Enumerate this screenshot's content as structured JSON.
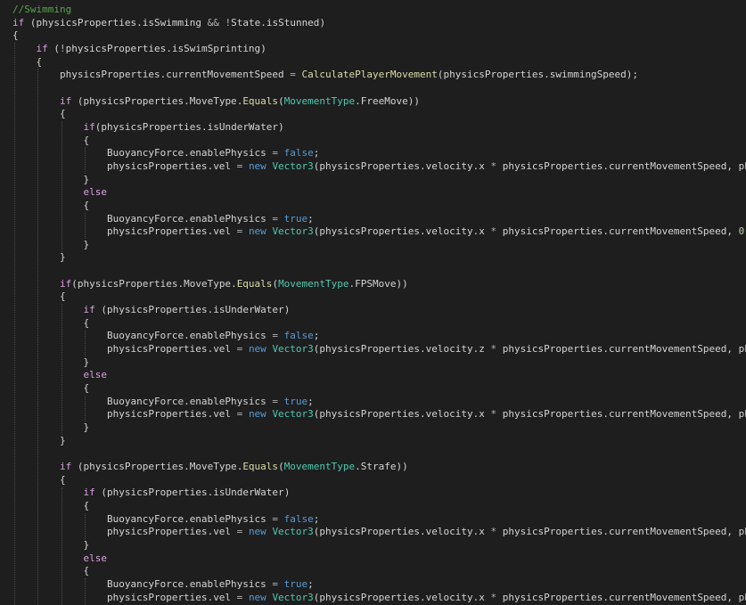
{
  "editor": {
    "language": "csharp",
    "colors": {
      "background": "#1e1e1e",
      "comment": "#57a64a",
      "keyword": "#569cd6",
      "control": "#d8a0df",
      "type": "#4ec9b0",
      "function": "#dcdcaa",
      "identifier": "#d4d4d4",
      "operator": "#b4b4b4",
      "number": "#b5cea8"
    },
    "lines": [
      [
        [
          "cm",
          "//Swimming"
        ]
      ],
      [
        [
          "ct",
          "if"
        ],
        [
          "pn",
          " ("
        ],
        [
          "id",
          "physicsProperties"
        ],
        [
          "pn",
          "."
        ],
        [
          "id",
          "isSwimming"
        ],
        [
          "op",
          " && "
        ],
        [
          "op",
          "!"
        ],
        [
          "id",
          "State"
        ],
        [
          "pn",
          "."
        ],
        [
          "id",
          "isStunned"
        ],
        [
          "pn",
          ")"
        ]
      ],
      [
        [
          "pn",
          "{"
        ]
      ],
      [
        [
          "pn",
          "    "
        ],
        [
          "ct",
          "if"
        ],
        [
          "pn",
          " ("
        ],
        [
          "op",
          "!"
        ],
        [
          "id",
          "physicsProperties"
        ],
        [
          "pn",
          "."
        ],
        [
          "id",
          "isSwimSprinting"
        ],
        [
          "pn",
          ")"
        ]
      ],
      [
        [
          "pn",
          "    {"
        ]
      ],
      [
        [
          "pn",
          "        "
        ],
        [
          "id",
          "physicsProperties"
        ],
        [
          "pn",
          "."
        ],
        [
          "id",
          "currentMovementSpeed"
        ],
        [
          "op",
          " = "
        ],
        [
          "fn",
          "CalculatePlayerMovement"
        ],
        [
          "pn",
          "("
        ],
        [
          "id",
          "physicsProperties"
        ],
        [
          "pn",
          "."
        ],
        [
          "id",
          "swimmingSpeed"
        ],
        [
          "pn",
          ");"
        ]
      ],
      [
        [
          "pn",
          ""
        ]
      ],
      [
        [
          "pn",
          "        "
        ],
        [
          "ct",
          "if"
        ],
        [
          "pn",
          " ("
        ],
        [
          "id",
          "physicsProperties"
        ],
        [
          "pn",
          "."
        ],
        [
          "id",
          "MoveType"
        ],
        [
          "pn",
          "."
        ],
        [
          "fn",
          "Equals"
        ],
        [
          "pn",
          "("
        ],
        [
          "ty",
          "MovementType"
        ],
        [
          "pn",
          "."
        ],
        [
          "id",
          "FreeMove"
        ],
        [
          "pn",
          "))"
        ]
      ],
      [
        [
          "pn",
          "        {"
        ]
      ],
      [
        [
          "pn",
          "            "
        ],
        [
          "ct",
          "if"
        ],
        [
          "pn",
          "("
        ],
        [
          "id",
          "physicsProperties"
        ],
        [
          "pn",
          "."
        ],
        [
          "id",
          "isUnderWater"
        ],
        [
          "pn",
          ")"
        ]
      ],
      [
        [
          "pn",
          "            {"
        ]
      ],
      [
        [
          "pn",
          "                "
        ],
        [
          "id",
          "BuoyancyForce"
        ],
        [
          "pn",
          "."
        ],
        [
          "id",
          "enablePhysics"
        ],
        [
          "op",
          " = "
        ],
        [
          "kw",
          "false"
        ],
        [
          "pn",
          ";"
        ]
      ],
      [
        [
          "pn",
          "                "
        ],
        [
          "id",
          "physicsProperties"
        ],
        [
          "pn",
          "."
        ],
        [
          "id",
          "vel"
        ],
        [
          "op",
          " = "
        ],
        [
          "kw",
          "new"
        ],
        [
          "pn",
          " "
        ],
        [
          "ty",
          "Vector3"
        ],
        [
          "pn",
          "("
        ],
        [
          "id",
          "physicsProperties"
        ],
        [
          "pn",
          "."
        ],
        [
          "id",
          "velocity"
        ],
        [
          "pn",
          "."
        ],
        [
          "id",
          "x"
        ],
        [
          "op",
          " * "
        ],
        [
          "id",
          "physicsProperties"
        ],
        [
          "pn",
          "."
        ],
        [
          "id",
          "currentMovementSpeed"
        ],
        [
          "pn",
          ", "
        ],
        [
          "id",
          "ph"
        ]
      ],
      [
        [
          "pn",
          "            }"
        ]
      ],
      [
        [
          "pn",
          "            "
        ],
        [
          "ct",
          "else"
        ]
      ],
      [
        [
          "pn",
          "            {"
        ]
      ],
      [
        [
          "pn",
          "                "
        ],
        [
          "id",
          "BuoyancyForce"
        ],
        [
          "pn",
          "."
        ],
        [
          "id",
          "enablePhysics"
        ],
        [
          "op",
          " = "
        ],
        [
          "kw",
          "true"
        ],
        [
          "pn",
          ";"
        ]
      ],
      [
        [
          "pn",
          "                "
        ],
        [
          "id",
          "physicsProperties"
        ],
        [
          "pn",
          "."
        ],
        [
          "id",
          "vel"
        ],
        [
          "op",
          " = "
        ],
        [
          "kw",
          "new"
        ],
        [
          "pn",
          " "
        ],
        [
          "ty",
          "Vector3"
        ],
        [
          "pn",
          "("
        ],
        [
          "id",
          "physicsProperties"
        ],
        [
          "pn",
          "."
        ],
        [
          "id",
          "velocity"
        ],
        [
          "pn",
          "."
        ],
        [
          "id",
          "x"
        ],
        [
          "op",
          " * "
        ],
        [
          "id",
          "physicsProperties"
        ],
        [
          "pn",
          "."
        ],
        [
          "id",
          "currentMovementSpeed"
        ],
        [
          "pn",
          ", "
        ],
        [
          "nm",
          "0"
        ]
      ],
      [
        [
          "pn",
          "            }"
        ]
      ],
      [
        [
          "pn",
          "        }"
        ]
      ],
      [
        [
          "pn",
          ""
        ]
      ],
      [
        [
          "pn",
          "        "
        ],
        [
          "ct",
          "if"
        ],
        [
          "pn",
          "("
        ],
        [
          "id",
          "physicsProperties"
        ],
        [
          "pn",
          "."
        ],
        [
          "id",
          "MoveType"
        ],
        [
          "pn",
          "."
        ],
        [
          "fn",
          "Equals"
        ],
        [
          "pn",
          "("
        ],
        [
          "ty",
          "MovementType"
        ],
        [
          "pn",
          "."
        ],
        [
          "id",
          "FPSMove"
        ],
        [
          "pn",
          "))"
        ]
      ],
      [
        [
          "pn",
          "        {"
        ]
      ],
      [
        [
          "pn",
          "            "
        ],
        [
          "ct",
          "if"
        ],
        [
          "pn",
          " ("
        ],
        [
          "id",
          "physicsProperties"
        ],
        [
          "pn",
          "."
        ],
        [
          "id",
          "isUnderWater"
        ],
        [
          "pn",
          ")"
        ]
      ],
      [
        [
          "pn",
          "            {"
        ]
      ],
      [
        [
          "pn",
          "                "
        ],
        [
          "id",
          "BuoyancyForce"
        ],
        [
          "pn",
          "."
        ],
        [
          "id",
          "enablePhysics"
        ],
        [
          "op",
          " = "
        ],
        [
          "kw",
          "false"
        ],
        [
          "pn",
          ";"
        ]
      ],
      [
        [
          "pn",
          "                "
        ],
        [
          "id",
          "physicsProperties"
        ],
        [
          "pn",
          "."
        ],
        [
          "id",
          "vel"
        ],
        [
          "op",
          " = "
        ],
        [
          "kw",
          "new"
        ],
        [
          "pn",
          " "
        ],
        [
          "ty",
          "Vector3"
        ],
        [
          "pn",
          "("
        ],
        [
          "id",
          "physicsProperties"
        ],
        [
          "pn",
          "."
        ],
        [
          "id",
          "velocity"
        ],
        [
          "pn",
          "."
        ],
        [
          "id",
          "z"
        ],
        [
          "op",
          " * "
        ],
        [
          "id",
          "physicsProperties"
        ],
        [
          "pn",
          "."
        ],
        [
          "id",
          "currentMovementSpeed"
        ],
        [
          "pn",
          ", "
        ],
        [
          "id",
          "ph"
        ]
      ],
      [
        [
          "pn",
          "            }"
        ]
      ],
      [
        [
          "pn",
          "            "
        ],
        [
          "ct",
          "else"
        ]
      ],
      [
        [
          "pn",
          "            {"
        ]
      ],
      [
        [
          "pn",
          "                "
        ],
        [
          "id",
          "BuoyancyForce"
        ],
        [
          "pn",
          "."
        ],
        [
          "id",
          "enablePhysics"
        ],
        [
          "op",
          " = "
        ],
        [
          "kw",
          "true"
        ],
        [
          "pn",
          ";"
        ]
      ],
      [
        [
          "pn",
          "                "
        ],
        [
          "id",
          "physicsProperties"
        ],
        [
          "pn",
          "."
        ],
        [
          "id",
          "vel"
        ],
        [
          "op",
          " = "
        ],
        [
          "kw",
          "new"
        ],
        [
          "pn",
          " "
        ],
        [
          "ty",
          "Vector3"
        ],
        [
          "pn",
          "("
        ],
        [
          "id",
          "physicsProperties"
        ],
        [
          "pn",
          "."
        ],
        [
          "id",
          "velocity"
        ],
        [
          "pn",
          "."
        ],
        [
          "id",
          "x"
        ],
        [
          "op",
          " * "
        ],
        [
          "id",
          "physicsProperties"
        ],
        [
          "pn",
          "."
        ],
        [
          "id",
          "currentMovementSpeed"
        ],
        [
          "pn",
          ", "
        ],
        [
          "id",
          "ph"
        ]
      ],
      [
        [
          "pn",
          "            }"
        ]
      ],
      [
        [
          "pn",
          "        }"
        ]
      ],
      [
        [
          "pn",
          ""
        ]
      ],
      [
        [
          "pn",
          "        "
        ],
        [
          "ct",
          "if"
        ],
        [
          "pn",
          " ("
        ],
        [
          "id",
          "physicsProperties"
        ],
        [
          "pn",
          "."
        ],
        [
          "id",
          "MoveType"
        ],
        [
          "pn",
          "."
        ],
        [
          "fn",
          "Equals"
        ],
        [
          "pn",
          "("
        ],
        [
          "ty",
          "MovementType"
        ],
        [
          "pn",
          "."
        ],
        [
          "id",
          "Strafe"
        ],
        [
          "pn",
          "))"
        ]
      ],
      [
        [
          "pn",
          "        {"
        ]
      ],
      [
        [
          "pn",
          "            "
        ],
        [
          "ct",
          "if"
        ],
        [
          "pn",
          " ("
        ],
        [
          "id",
          "physicsProperties"
        ],
        [
          "pn",
          "."
        ],
        [
          "id",
          "isUnderWater"
        ],
        [
          "pn",
          ")"
        ]
      ],
      [
        [
          "pn",
          "            {"
        ]
      ],
      [
        [
          "pn",
          "                "
        ],
        [
          "id",
          "BuoyancyForce"
        ],
        [
          "pn",
          "."
        ],
        [
          "id",
          "enablePhysics"
        ],
        [
          "op",
          " = "
        ],
        [
          "kw",
          "false"
        ],
        [
          "pn",
          ";"
        ]
      ],
      [
        [
          "pn",
          "                "
        ],
        [
          "id",
          "physicsProperties"
        ],
        [
          "pn",
          "."
        ],
        [
          "id",
          "vel"
        ],
        [
          "op",
          " = "
        ],
        [
          "kw",
          "new"
        ],
        [
          "pn",
          " "
        ],
        [
          "ty",
          "Vector3"
        ],
        [
          "pn",
          "("
        ],
        [
          "id",
          "physicsProperties"
        ],
        [
          "pn",
          "."
        ],
        [
          "id",
          "velocity"
        ],
        [
          "pn",
          "."
        ],
        [
          "id",
          "x"
        ],
        [
          "op",
          " * "
        ],
        [
          "id",
          "physicsProperties"
        ],
        [
          "pn",
          "."
        ],
        [
          "id",
          "currentMovementSpeed"
        ],
        [
          "pn",
          ", "
        ],
        [
          "id",
          "ph"
        ]
      ],
      [
        [
          "pn",
          "            }"
        ]
      ],
      [
        [
          "pn",
          "            "
        ],
        [
          "ct",
          "else"
        ]
      ],
      [
        [
          "pn",
          "            {"
        ]
      ],
      [
        [
          "pn",
          "                "
        ],
        [
          "id",
          "BuoyancyForce"
        ],
        [
          "pn",
          "."
        ],
        [
          "id",
          "enablePhysics"
        ],
        [
          "op",
          " = "
        ],
        [
          "kw",
          "true"
        ],
        [
          "pn",
          ";"
        ]
      ],
      [
        [
          "pn",
          "                "
        ],
        [
          "id",
          "physicsProperties"
        ],
        [
          "pn",
          "."
        ],
        [
          "id",
          "vel"
        ],
        [
          "op",
          " = "
        ],
        [
          "kw",
          "new"
        ],
        [
          "pn",
          " "
        ],
        [
          "ty",
          "Vector3"
        ],
        [
          "pn",
          "("
        ],
        [
          "id",
          "physicsProperties"
        ],
        [
          "pn",
          "."
        ],
        [
          "id",
          "velocity"
        ],
        [
          "pn",
          "."
        ],
        [
          "id",
          "x"
        ],
        [
          "op",
          " * "
        ],
        [
          "id",
          "physicsProperties"
        ],
        [
          "pn",
          "."
        ],
        [
          "id",
          "currentMovementSpeed"
        ],
        [
          "pn",
          ", "
        ],
        [
          "id",
          "ph"
        ]
      ]
    ]
  }
}
